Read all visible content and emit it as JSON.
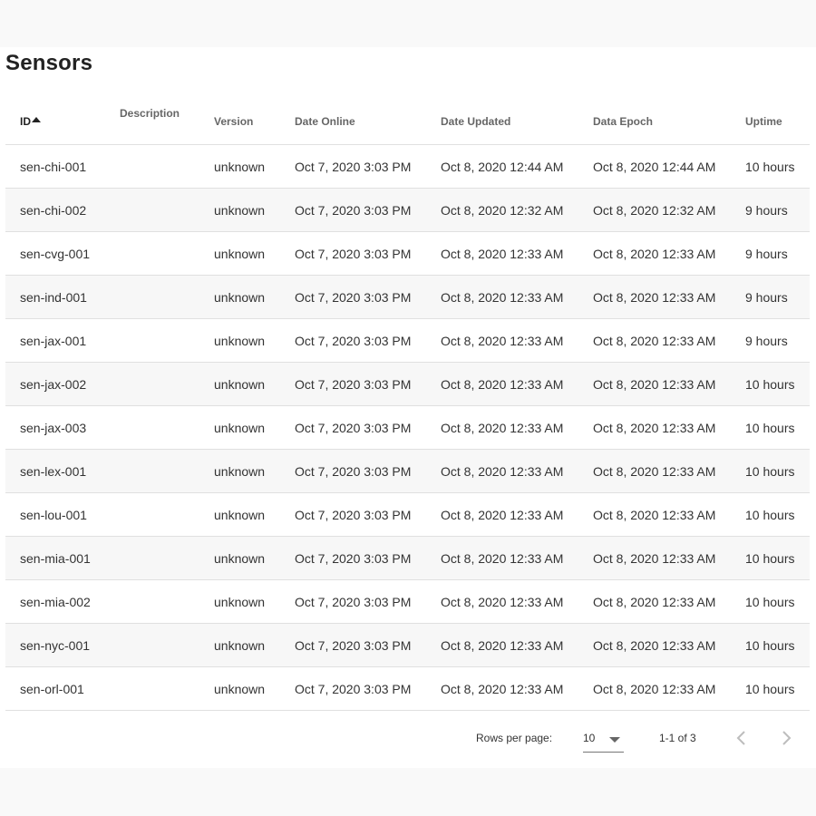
{
  "page": {
    "title": "Sensors"
  },
  "table": {
    "columns": [
      "ID",
      "Description",
      "Version",
      "Date Online",
      "Date Updated",
      "Data Epoch",
      "Uptime"
    ],
    "rows": [
      [
        "sen-chi-001",
        "",
        "unknown",
        "Oct 7, 2020 3:03 PM",
        "Oct 8, 2020 12:44 AM",
        "Oct 8, 2020 12:44 AM",
        "10 hours"
      ],
      [
        "sen-chi-002",
        "",
        "unknown",
        "Oct 7, 2020 3:03 PM",
        "Oct 8, 2020 12:32 AM",
        "Oct 8, 2020 12:32 AM",
        "9 hours"
      ],
      [
        "sen-cvg-001",
        "",
        "unknown",
        "Oct 7, 2020 3:03 PM",
        "Oct 8, 2020 12:33 AM",
        "Oct 8, 2020 12:33 AM",
        "9 hours"
      ],
      [
        "sen-ind-001",
        "",
        "unknown",
        "Oct 7, 2020 3:03 PM",
        "Oct 8, 2020 12:33 AM",
        "Oct 8, 2020 12:33 AM",
        "9 hours"
      ],
      [
        "sen-jax-001",
        "",
        "unknown",
        "Oct 7, 2020 3:03 PM",
        "Oct 8, 2020 12:33 AM",
        "Oct 8, 2020 12:33 AM",
        "9 hours"
      ],
      [
        "sen-jax-002",
        "",
        "unknown",
        "Oct 7, 2020 3:03 PM",
        "Oct 8, 2020 12:33 AM",
        "Oct 8, 2020 12:33 AM",
        "10 hours"
      ],
      [
        "sen-jax-003",
        "",
        "unknown",
        "Oct 7, 2020 3:03 PM",
        "Oct 8, 2020 12:33 AM",
        "Oct 8, 2020 12:33 AM",
        "10 hours"
      ],
      [
        "sen-lex-001",
        "",
        "unknown",
        "Oct 7, 2020 3:03 PM",
        "Oct 8, 2020 12:33 AM",
        "Oct 8, 2020 12:33 AM",
        "10 hours"
      ],
      [
        "sen-lou-001",
        "",
        "unknown",
        "Oct 7, 2020 3:03 PM",
        "Oct 8, 2020 12:33 AM",
        "Oct 8, 2020 12:33 AM",
        "10 hours"
      ],
      [
        "sen-mia-001",
        "",
        "unknown",
        "Oct 7, 2020 3:03 PM",
        "Oct 8, 2020 12:33 AM",
        "Oct 8, 2020 12:33 AM",
        "10 hours"
      ],
      [
        "sen-mia-002",
        "",
        "unknown",
        "Oct 7, 2020 3:03 PM",
        "Oct 8, 2020 12:33 AM",
        "Oct 8, 2020 12:33 AM",
        "10 hours"
      ],
      [
        "sen-nyc-001",
        "",
        "unknown",
        "Oct 7, 2020 3:03 PM",
        "Oct 8, 2020 12:33 AM",
        "Oct 8, 2020 12:33 AM",
        "10 hours"
      ],
      [
        "sen-orl-001",
        "",
        "unknown",
        "Oct 7, 2020 3:03 PM",
        "Oct 8, 2020 12:33 AM",
        "Oct 8, 2020 12:33 AM",
        "10 hours"
      ]
    ],
    "sort": {
      "column": "ID",
      "direction": "ascending",
      "icon": "sort-ascending-icon"
    }
  },
  "pagination": {
    "rows_per_page_label": "Rows per page:",
    "rows_per_page_value": "10",
    "range": "1-1 of 3",
    "icons": {
      "prev": "chevron-left-icon",
      "next": "chevron-right-icon",
      "select": "caret-down-icon"
    }
  },
  "colors": {
    "text": "#222222",
    "header_text": "#666666",
    "divider": "#e0e0e0",
    "stripe": "#f7f7f7",
    "background": "#f9f9f9",
    "disabled_icon": "#bdbdbd"
  }
}
